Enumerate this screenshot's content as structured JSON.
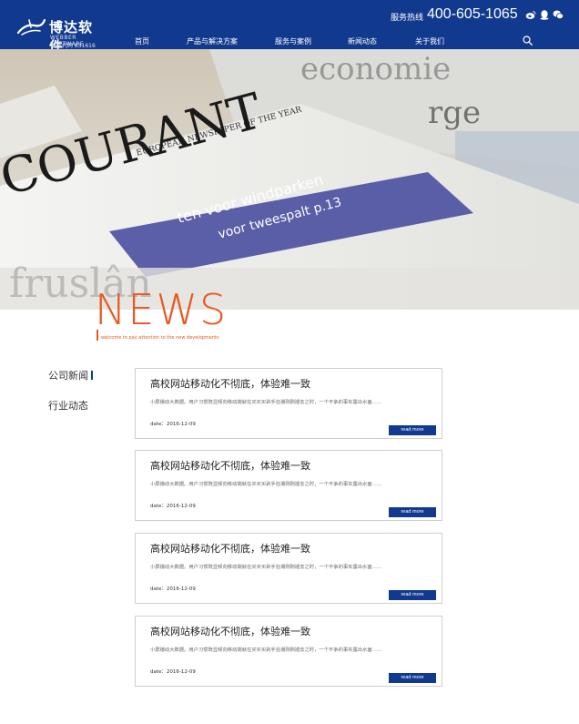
{
  "header": {
    "logo": {
      "name": "博达软件",
      "name_en": "WEBBER SOFTWARE",
      "stock_code": "证券代码 831616"
    },
    "hotline_label": "服务热线",
    "hotline_number": "400-605-1065",
    "social_icons": [
      "weibo-icon",
      "qq-icon",
      "wechat-icon"
    ],
    "nav": [
      {
        "label": "首页",
        "active": false
      },
      {
        "label": "产品与解决方案",
        "active": false
      },
      {
        "label": "服务与案例",
        "active": false
      },
      {
        "label": "新闻动态",
        "active": true
      },
      {
        "label": "关于我们",
        "active": false
      }
    ],
    "search_icon": "search-icon",
    "accent_color": "#113a8e",
    "active_underline_color": "#e8502a"
  },
  "banner": {
    "headline_fragments": [
      "EUROPEAN NEWSPAPER OF THE YEAR",
      "COURANT",
      "economie",
      "rge",
      "ten voor windparken",
      "voor tweespalt p.13",
      "fruslân"
    ]
  },
  "news_heading": {
    "title": "NEWS",
    "subtitle": "welcome to pay attention to the new developments",
    "color": "#e8581d"
  },
  "sidebar": {
    "items": [
      {
        "label": "公司新闻",
        "active": true
      },
      {
        "label": "行业动态",
        "active": false
      }
    ]
  },
  "articles": [
    {
      "title": "高校网站移动化不彻底，体验难一致",
      "summary": "小屏播动大数据。用户习惯既显频向移动端就在买买买剁手狂潮刚刚褪去之时，一个不争的事实露出水面……",
      "date": "date：2016-12-09",
      "button": "read more"
    },
    {
      "title": "高校网站移动化不彻底，体验难一致",
      "summary": "小屏播动大数据。用户习惯既显频向移动端就在买买买剁手狂潮刚刚褪去之时，一个不争的事实露出水面……",
      "date": "date：2016-12-09",
      "button": "read more"
    },
    {
      "title": "高校网站移动化不彻底，体验难一致",
      "summary": "小屏播动大数据。用户习惯既显频向移动端就在买买买剁手狂潮刚刚褪去之时，一个不争的事实露出水面……",
      "date": "date：2016-12-09",
      "button": "read more"
    },
    {
      "title": "高校网站移动化不彻底，体验难一致",
      "summary": "小屏播动大数据。用户习惯既显频向移动端就在买买买剁手狂潮刚刚褪去之时，一个不争的事实露出水面……",
      "date": "date：2016-12-09",
      "button": "read more"
    }
  ]
}
